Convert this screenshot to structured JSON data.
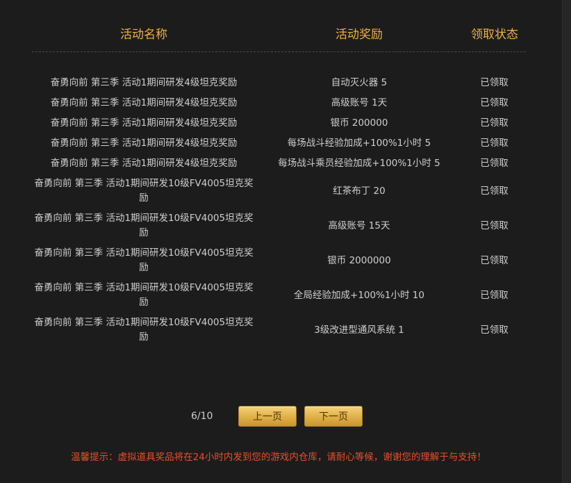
{
  "table": {
    "headers": {
      "name": "活动名称",
      "reward": "活动奖励",
      "status": "领取状态"
    },
    "rows": [
      {
        "name": "奋勇向前 第三季 活动1期间研发4级坦克奖励",
        "reward": "自动灭火器 5",
        "status": "已领取"
      },
      {
        "name": "奋勇向前 第三季 活动1期间研发4级坦克奖励",
        "reward": "高级账号 1天",
        "status": "已领取"
      },
      {
        "name": "奋勇向前 第三季 活动1期间研发4级坦克奖励",
        "reward": "银币 200000",
        "status": "已领取"
      },
      {
        "name": "奋勇向前 第三季 活动1期间研发4级坦克奖励",
        "reward": "每场战斗经验加成+100%1小时 5",
        "status": "已领取"
      },
      {
        "name": "奋勇向前 第三季 活动1期间研发4级坦克奖励",
        "reward": "每场战斗乘员经验加成+100%1小时 5",
        "status": "已领取"
      },
      {
        "name": "奋勇向前 第三季 活动1期间研发10级FV4005坦克奖励",
        "reward": "红茶布丁 20",
        "status": "已领取"
      },
      {
        "name": "奋勇向前 第三季 活动1期间研发10级FV4005坦克奖励",
        "reward": "高级账号 15天",
        "status": "已领取"
      },
      {
        "name": "奋勇向前 第三季 活动1期间研发10级FV4005坦克奖励",
        "reward": "银币 2000000",
        "status": "已领取"
      },
      {
        "name": "奋勇向前 第三季 活动1期间研发10级FV4005坦克奖励",
        "reward": "全局经验加成+100%1小时 10",
        "status": "已领取"
      },
      {
        "name": "奋勇向前 第三季 活动1期间研发10级FV4005坦克奖励",
        "reward": "3级改进型通风系统 1",
        "status": "已领取"
      }
    ]
  },
  "pagination": {
    "page_indicator": "6/10",
    "prev_label": "上一页",
    "next_label": "下一页"
  },
  "notice": "温馨提示：虚拟道具奖品将在24小时内发到您的游戏内仓库，请耐心等候，谢谢您的理解于与支持！",
  "colors": {
    "background": "#1c1c1c",
    "header_text": "#f0b23a",
    "notice_text": "#e8502a",
    "button_gold": "#e2b24a"
  }
}
